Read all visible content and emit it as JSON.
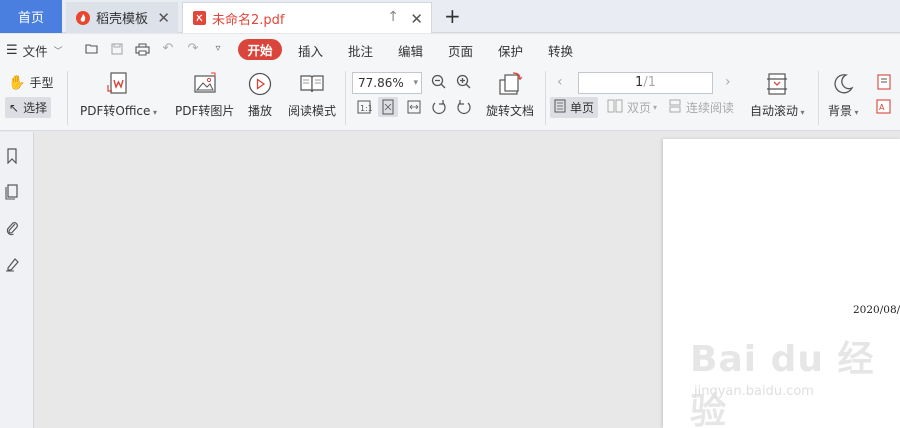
{
  "tabs": {
    "home": "首页",
    "template": "稻壳模板",
    "file": "未命名2.pdf"
  },
  "menu": {
    "file": "文件",
    "items": [
      "开始",
      "插入",
      "批注",
      "编辑",
      "页面",
      "保护",
      "转换"
    ]
  },
  "ribbon": {
    "hand": "手型",
    "select": "选择",
    "pdf_to_office": "PDF转Office",
    "pdf_to_image": "PDF转图片",
    "play": "播放",
    "read_mode": "阅读模式",
    "zoom": "77.86%",
    "rotate_doc": "旋转文档",
    "page_current": "1",
    "page_total": "/1",
    "single_page": "单页",
    "double_page": "双页",
    "continuous": "连续阅读",
    "auto_scroll": "自动滚动",
    "background": "背景"
  },
  "document": {
    "date_text": "2020/08/"
  },
  "watermark": {
    "main": "Bai du 经验",
    "sub": "jingyan.baidu.com"
  },
  "colors": {
    "accent_tab": "#4a7fe0",
    "active_menu": "#d9453a",
    "pdf_red": "#e2463b"
  }
}
